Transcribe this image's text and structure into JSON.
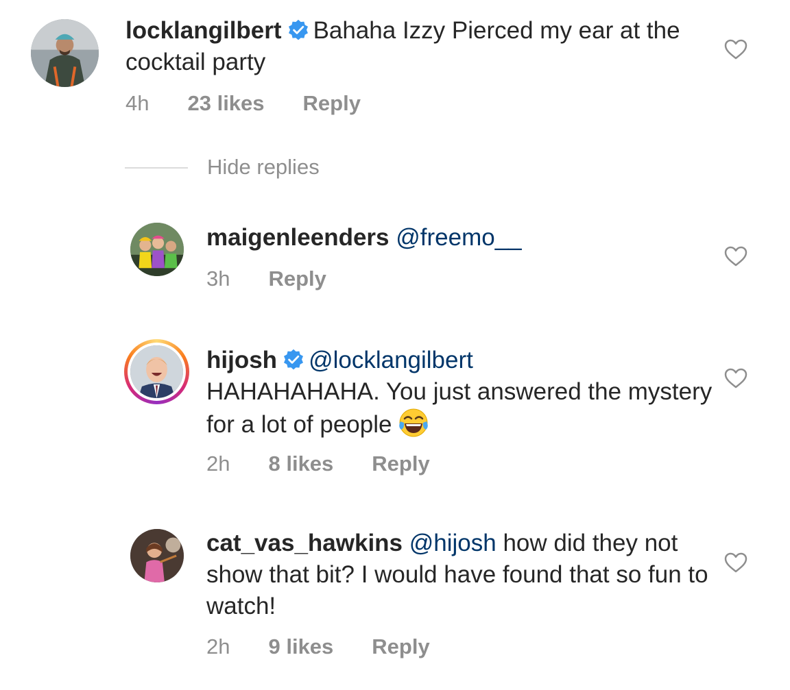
{
  "comments": [
    {
      "username": "locklangilbert",
      "verified": true,
      "text": "Bahaha Izzy Pierced my ear at the cocktail party",
      "time": "4h",
      "likes": "23 likes",
      "reply": "Reply"
    },
    {
      "username": "maigenleenders",
      "mention": "@freemo__",
      "time": "3h",
      "reply": "Reply"
    },
    {
      "username": "hijosh",
      "verified": true,
      "mention": "@locklangilbert",
      "text": "HAHAHAHAHA. You just answered the mystery for a lot of people",
      "time": "2h",
      "likes": "8 likes",
      "reply": "Reply"
    },
    {
      "username": "cat_vas_hawkins",
      "mention": "@hijosh",
      "text": "how did they not show that bit? I would have found that so fun to watch!",
      "time": "2h",
      "likes": "9 likes",
      "reply": "Reply"
    }
  ],
  "hide_replies": "Hide replies",
  "colors": {
    "text": "#262626",
    "meta": "#8e8e8e",
    "mention": "#003569",
    "verified": "#3897f0"
  },
  "icons": [
    "verified-badge-icon",
    "heart-outline-icon",
    "laughing-tears-emoji"
  ]
}
